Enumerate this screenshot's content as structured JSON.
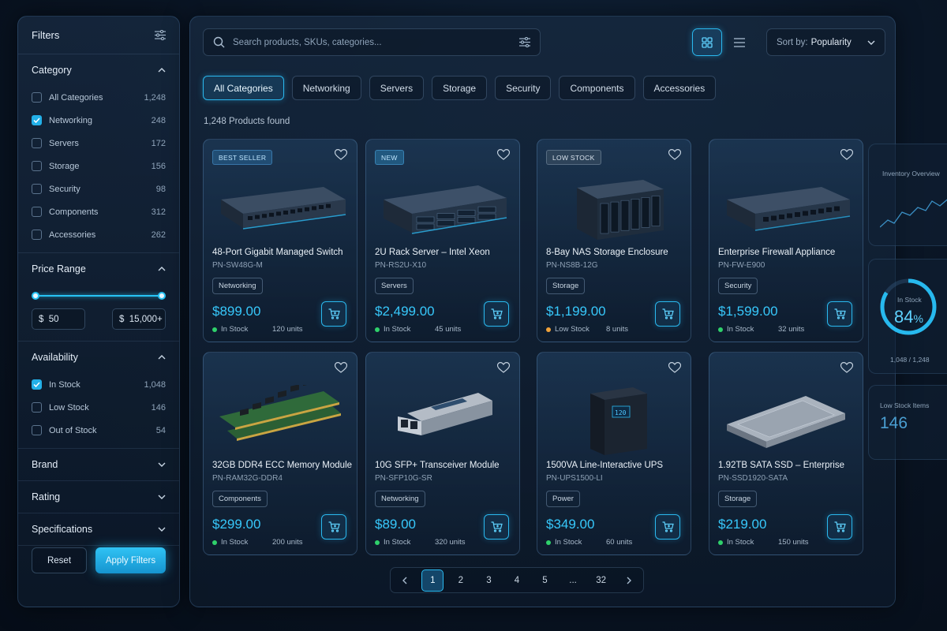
{
  "filters": {
    "title": "Filters",
    "category": {
      "title": "Category",
      "items": [
        {
          "label": "All Categories",
          "count": "1,248",
          "checked": false
        },
        {
          "label": "Networking",
          "count": "248",
          "checked": true
        },
        {
          "label": "Servers",
          "count": "172",
          "checked": false
        },
        {
          "label": "Storage",
          "count": "156",
          "checked": false
        },
        {
          "label": "Security",
          "count": "98",
          "checked": false
        },
        {
          "label": "Components",
          "count": "312",
          "checked": false
        },
        {
          "label": "Accessories",
          "count": "262",
          "checked": false
        }
      ]
    },
    "price": {
      "title": "Price Range",
      "min": "$  50",
      "max": "$  15,000+"
    },
    "availability": {
      "title": "Availability",
      "items": [
        {
          "label": "In Stock",
          "count": "1,048",
          "checked": true
        },
        {
          "label": "Low Stock",
          "count": "146",
          "checked": false
        },
        {
          "label": "Out of Stock",
          "count": "54",
          "checked": false
        }
      ]
    },
    "brand": "Brand",
    "rating": "Rating",
    "specifications": "Specifications",
    "reset": "Reset",
    "apply": "Apply Filters"
  },
  "toolbar": {
    "search_placeholder": "Search products, SKUs, categories...",
    "sort_prefix": "Sort by:",
    "sort_value": "Popularity"
  },
  "chips": [
    "All Categories",
    "Networking",
    "Servers",
    "Storage",
    "Security",
    "Components",
    "Accessories"
  ],
  "found": "1,248 Products found",
  "products": [
    {
      "badge": "BEST SELLER",
      "name": "48-Port Gigabit Managed Switch",
      "sku": "PN-SW48G-M",
      "tag": "Networking",
      "price": "$899.00",
      "stock": "In Stock",
      "units": "120 units",
      "stock_color": "#2fd16b",
      "icon": "switch-image"
    },
    {
      "badge": "NEW",
      "name": "2U Rack Server – Intel Xeon",
      "sku": "PN-RS2U-X10",
      "tag": "Servers",
      "price": "$2,499.00",
      "stock": "In Stock",
      "units": "45 units",
      "stock_color": "#2fd16b",
      "icon": "server-image"
    },
    {
      "badge": "LOW STOCK",
      "name": "8-Bay NAS Storage Enclosure",
      "sku": "PN-NS8B-12G",
      "tag": "Storage",
      "price": "$1,199.00",
      "stock": "Low Stock",
      "units": "8 units",
      "stock_color": "#f0a23a",
      "icon": "nas-image"
    },
    {
      "badge": "",
      "name": "Enterprise Firewall Appliance",
      "sku": "PN-FW-E900",
      "tag": "Security",
      "price": "$1,599.00",
      "stock": "In Stock",
      "units": "32 units",
      "stock_color": "#2fd16b",
      "icon": "firewall-image"
    },
    {
      "badge": "",
      "name": "32GB DDR4 ECC Memory Module",
      "sku": "PN-RAM32G-DDR4",
      "tag": "Components",
      "price": "$299.00",
      "stock": "In Stock",
      "units": "200 units",
      "stock_color": "#2fd16b",
      "icon": "ram-image"
    },
    {
      "badge": "",
      "name": "10G SFP+ Transceiver Module",
      "sku": "PN-SFP10G-SR",
      "tag": "Networking",
      "price": "$89.00",
      "stock": "In Stock",
      "units": "320 units",
      "stock_color": "#2fd16b",
      "icon": "sfp-image"
    },
    {
      "badge": "",
      "name": "1500VA Line-Interactive UPS",
      "sku": "PN-UPS1500-LI",
      "tag": "Power",
      "price": "$349.00",
      "stock": "In Stock",
      "units": "60 units",
      "stock_color": "#2fd16b",
      "icon": "ups-image"
    },
    {
      "badge": "",
      "name": "1.92TB SATA SSD – Enterprise",
      "sku": "PN-SSD1920-SATA",
      "tag": "Storage",
      "price": "$219.00",
      "stock": "In Stock",
      "units": "150 units",
      "stock_color": "#2fd16b",
      "icon": "ssd-image"
    }
  ],
  "pagination": [
    "1",
    "2",
    "3",
    "4",
    "5",
    "...",
    "32"
  ],
  "dashboard": {
    "overview_title": "Inventory Overview",
    "in_stock_label": "In Stock",
    "in_stock_pct": "84",
    "in_stock_pct_unit": "%",
    "in_stock_fraction": 0.84,
    "in_stock_ratio": "1,048 / 1,248",
    "low_stock_label": "Low Stock Items",
    "low_stock_value": "146"
  },
  "colors": {
    "accent": "#27c4f5",
    "in_stock": "#2fd16b",
    "low_stock": "#f0a23a"
  }
}
